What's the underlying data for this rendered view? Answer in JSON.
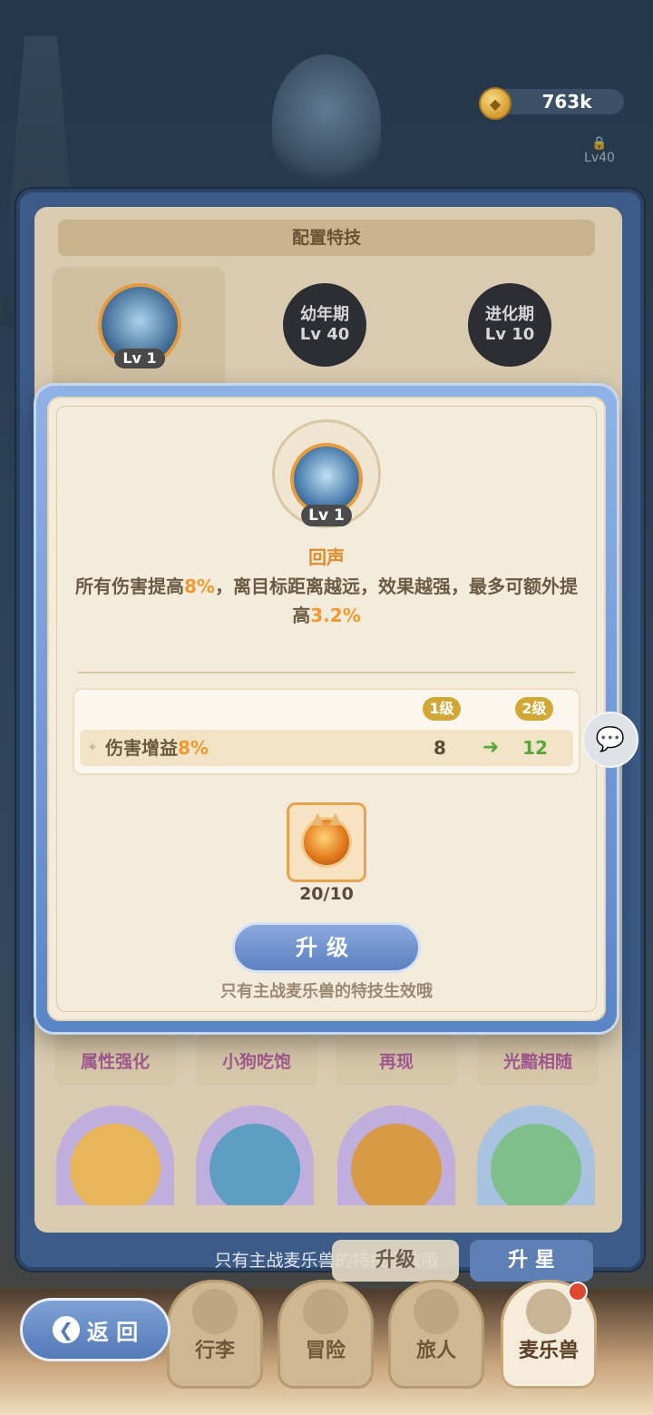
{
  "currency": {
    "value": "763k",
    "icon": "coin-icon"
  },
  "locked_top": {
    "text": "Lv40"
  },
  "back_panel": {
    "title": "配置特技",
    "slots": [
      {
        "label": "Lv 1"
      },
      {
        "line1": "幼年期",
        "line2": "Lv 40"
      },
      {
        "line1": "进化期",
        "line2": "Lv 10"
      }
    ],
    "tags": [
      "属性强化",
      "小狗吃饱",
      "再现",
      "光黯相随"
    ],
    "tip": "只有主战麦乐兽的特技生效哦",
    "upgrade_label": "升级",
    "star_label": "升 星"
  },
  "modal": {
    "medal_level": "Lv 1",
    "skill_name": "回声",
    "desc": {
      "p1": "所有伤害提高",
      "v1": "8%",
      "p2": "，离目标距离越远，效果越强，最多可额外提高",
      "v2": "3.2%"
    },
    "levels": {
      "from": "1级",
      "to": "2级"
    },
    "stat": {
      "label": "伤害增益",
      "label_value": "8%",
      "from": "8",
      "arrow": "➜",
      "to": "12"
    },
    "item_count": "20/10",
    "upgrade_button": "升级",
    "tip": "只有主战麦乐兽的特技生效哦"
  },
  "nav": {
    "back_label": "返 回",
    "items": [
      "行李",
      "冒险",
      "旅人",
      "麦乐兽"
    ],
    "active": "麦乐兽"
  },
  "colors": {
    "accent": "#f0992f",
    "primary_button": "#5c80c0",
    "success": "#59a53b"
  }
}
